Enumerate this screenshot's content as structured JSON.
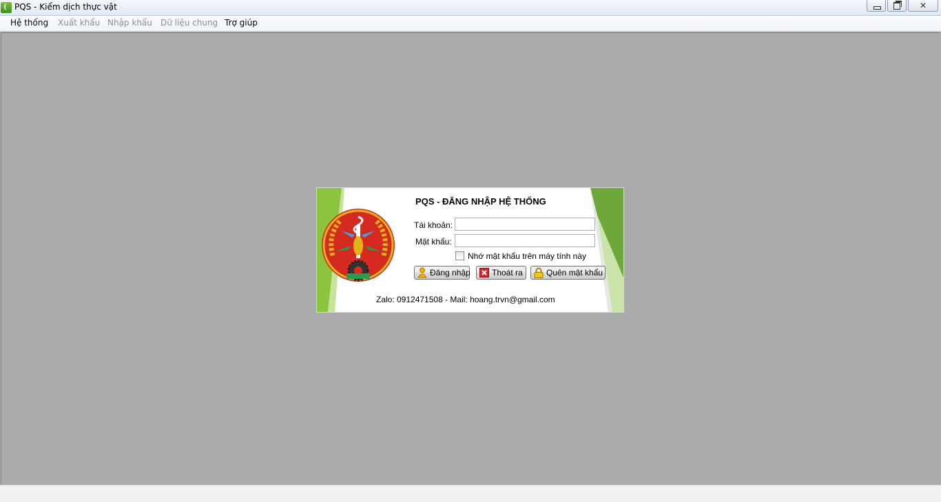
{
  "window": {
    "title": "PQS - Kiểm dịch thực vật",
    "icon": "app-leaf-icon",
    "controls": {
      "minimize": "minimize-icon",
      "maximize": "restore-icon",
      "close": "close-icon"
    },
    "close_glyph": "✕"
  },
  "menu": {
    "items": [
      {
        "label": "Hệ thống",
        "enabled": true
      },
      {
        "label": "Xuất khẩu",
        "enabled": false
      },
      {
        "label": "Nhập khẩu",
        "enabled": false
      },
      {
        "label": "Dữ liệu chung",
        "enabled": false
      },
      {
        "label": "Trợ giúp",
        "enabled": true
      }
    ]
  },
  "login": {
    "title": "PQS - ĐĂNG NHẬP HỆ THỐNG",
    "username_label": "Tài khoản:",
    "username_value": "",
    "password_label": "Mật khẩu:",
    "password_value": "",
    "remember_label": "Nhớ mật khẩu trên máy tính này",
    "remember_checked": false,
    "buttons": {
      "login": "Đăng nhập",
      "exit": "Thoát ra",
      "forgot": "Quên mật khẩu"
    },
    "contact": "Zalo: 0912471508 -  Mail: hoang.trvn@gmail.com"
  },
  "colors": {
    "workspace": "#ababab",
    "accent_green": "#6fa83a",
    "emblem_red": "#d42a1f",
    "emblem_gold": "#e3b21b"
  }
}
